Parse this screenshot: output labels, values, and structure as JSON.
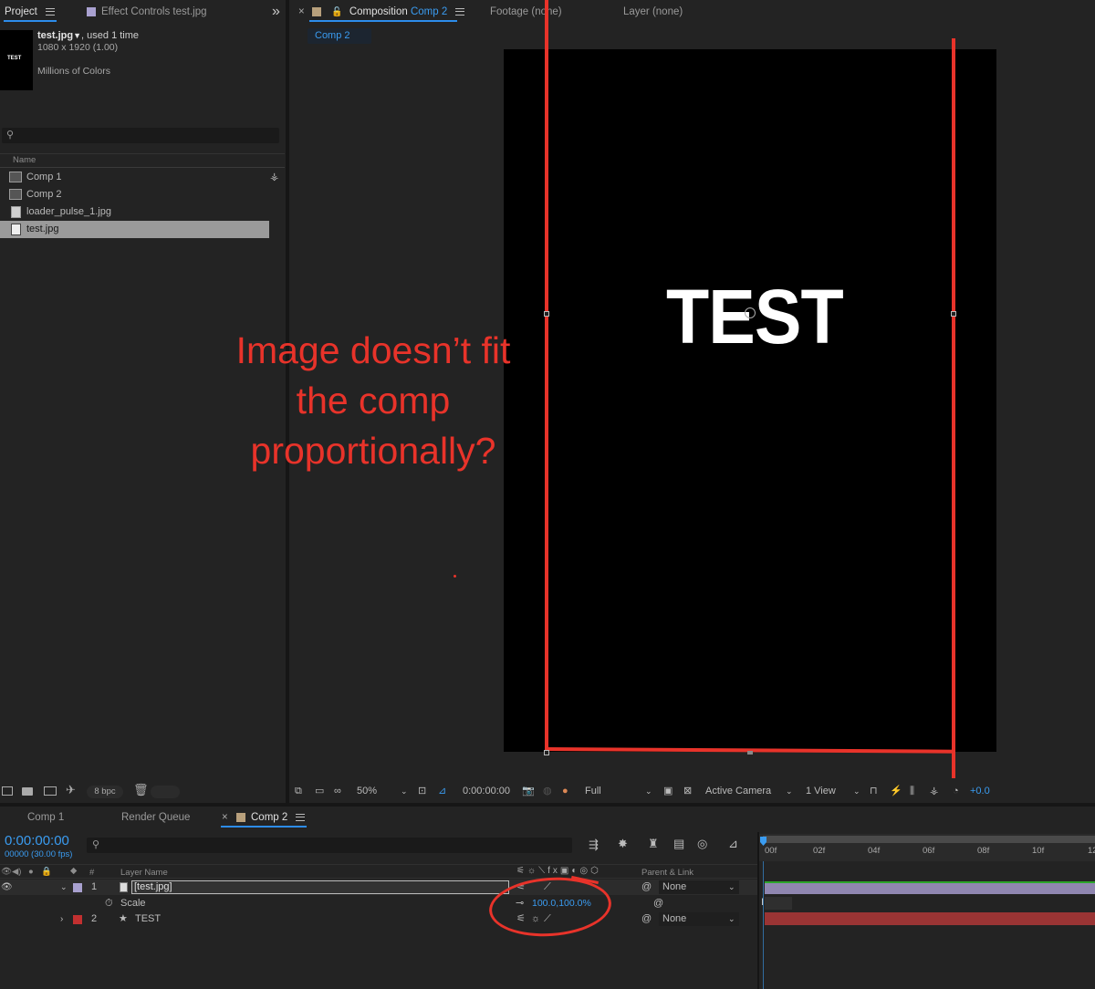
{
  "project_panel": {
    "tab_project": "Project",
    "tab_effect_controls": "Effect Controls test.jpg",
    "expand_glyph": "»",
    "thumb_text": "TEST",
    "selected_file": "test.jpg",
    "used_text": ", used 1 time",
    "dimensions": "1080 x 1920 (1.00)",
    "color_depth": "Millions of Colors",
    "column_name": "Name",
    "items": [
      {
        "label": "Comp 1",
        "kind": "comp"
      },
      {
        "label": "Comp 2",
        "kind": "comp"
      },
      {
        "label": "loader_pulse_1.jpg",
        "kind": "image"
      },
      {
        "label": "test.jpg",
        "kind": "image"
      }
    ],
    "bpc": "8 bpc"
  },
  "comp_panel": {
    "close_glyph": "×",
    "tab_composition_prefix": "Composition",
    "tab_composition_name": "Comp 2",
    "tab_footage": "Footage (none)",
    "tab_layer": "Layer (none)",
    "breadcrumb": "Comp 2",
    "canvas_text": "TEST",
    "annotation_lines": [
      "Image doesn’t fit",
      "the comp",
      "proportionally?"
    ],
    "toolbar": {
      "zoom": "50%",
      "timecode": "0:00:00:00",
      "resolution": "Full",
      "camera": "Active Camera",
      "views": "1 View",
      "exposure": "+0.0"
    }
  },
  "timeline": {
    "tab_comp1": "Comp 1",
    "tab_render_queue": "Render Queue",
    "tab_comp2": "Comp 2",
    "timecode": "0:00:00:00",
    "frame_info": "00000 (30.00 fps)",
    "col_hash": "#",
    "col_layer_name": "Layer Name",
    "col_parent": "Parent & Link",
    "ruler": [
      "00f",
      "02f",
      "04f",
      "06f",
      "08f",
      "10f",
      "12"
    ],
    "layers": [
      {
        "num": "1",
        "name": "[test.jpg]",
        "parent": "None",
        "label_color": "#a9a1d0"
      },
      {
        "num": "2",
        "name": "TEST",
        "parent": "None",
        "label_color": "#c23030"
      }
    ],
    "scale_label": "Scale",
    "scale_value": "100.0,100.0%"
  },
  "colors": {
    "accent": "#2d8ceb",
    "annotation_red": "#e8332a"
  }
}
